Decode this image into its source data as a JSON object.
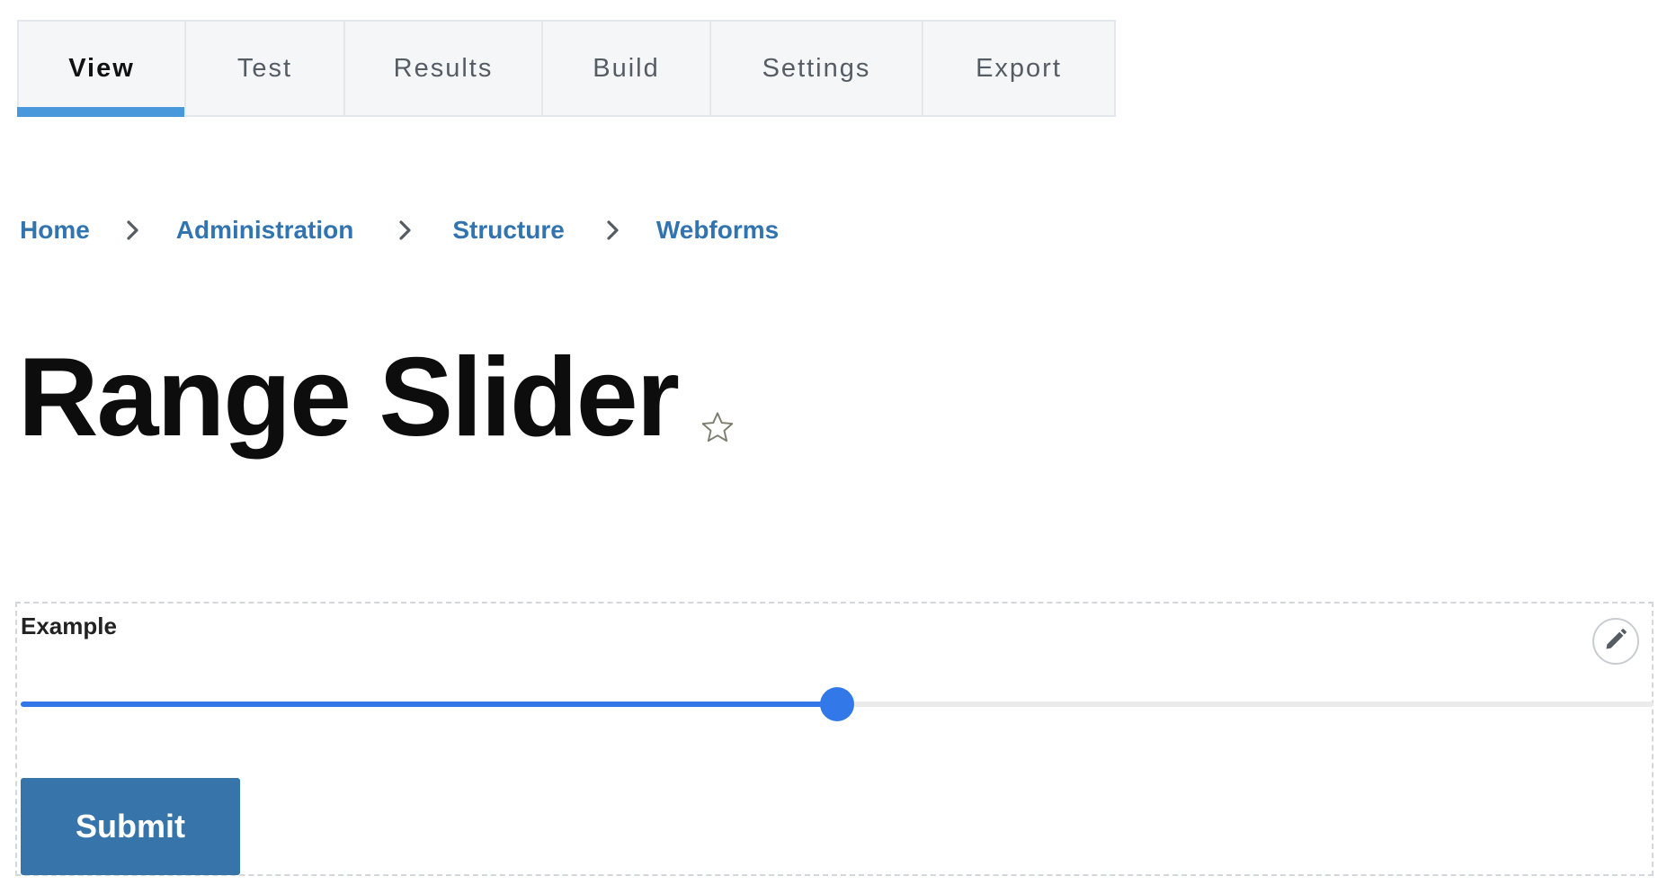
{
  "tabs": [
    {
      "label": "View",
      "active": true
    },
    {
      "label": "Test",
      "active": false
    },
    {
      "label": "Results",
      "active": false
    },
    {
      "label": "Build",
      "active": false
    },
    {
      "label": "Settings",
      "active": false
    },
    {
      "label": "Export",
      "active": false
    }
  ],
  "breadcrumb": [
    {
      "label": "Home"
    },
    {
      "label": "Administration"
    },
    {
      "label": "Structure"
    },
    {
      "label": "Webforms"
    }
  ],
  "page": {
    "title": "Range Slider",
    "favorite_icon": "star-outline-icon"
  },
  "form": {
    "field_label": "Example",
    "edit_icon": "pencil-icon",
    "slider": {
      "min": 0,
      "max": 100,
      "value": 50
    },
    "submit_label": "Submit"
  },
  "colors": {
    "tab_active_indicator": "#4a98dc",
    "link": "#3174b0",
    "slider_accent": "#3378e8",
    "submit_bg": "#3674aa"
  }
}
